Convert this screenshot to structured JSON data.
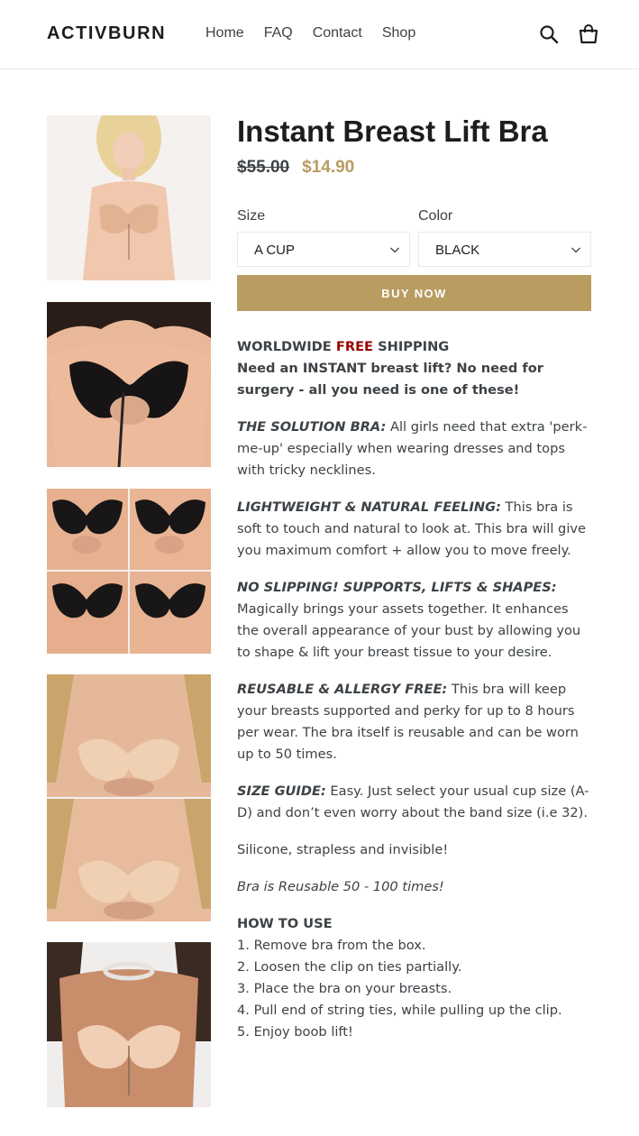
{
  "header": {
    "logo": "ACTIVBURN",
    "nav": [
      "Home",
      "FAQ",
      "Contact",
      "Shop"
    ],
    "search_icon": "search-icon",
    "cart_icon": "cart-icon"
  },
  "product": {
    "title": "Instant Breast Lift Bra",
    "price_original": "$55.00",
    "price_sale": "$14.90",
    "size_label": "Size",
    "size_value": "A CUP",
    "color_label": "Color",
    "color_value": "BLACK",
    "buy_label": "BUY NOW",
    "accent_color": "#b89c60"
  },
  "gallery": [
    {
      "alt": "model wearing nude strapless bra"
    },
    {
      "alt": "black adhesive bra close-up"
    },
    {
      "alt": "four-panel black bra lace-up"
    },
    {
      "alt": "nude bra before and after"
    },
    {
      "alt": "nude bra with choker necklace"
    }
  ],
  "description": {
    "shipping_pre": "WORLDWIDE ",
    "shipping_free": "FREE",
    "shipping_post": " SHIPPING",
    "intro": "Need an INSTANT breast lift? No need for surgery - all you need is one of these!",
    "solution_head": "THE SOLUTION BRA:",
    "solution_text": " All girls need that extra 'perk-me-up' especially when wearing dresses and tops with tricky necklines.",
    "light_head": "LIGHTWEIGHT & NATURAL FEELING:",
    "light_text": " This bra is soft to touch and natural to look at. This bra will give you maximum comfort + allow you to move freely.",
    "slip_head": "NO SLIPPING! SUPPORTS, LIFTS & SHAPES:",
    "slip_text": " Magically brings your assets together. It enhances the overall appearance of your bust by allowing you to shape & lift your breast tissue to your desire.",
    "reuse_head": "REUSABLE & ALLERGY FREE:",
    "reuse_text": " This bra will keep your breasts supported and perky for up to 8 hours per wear. The bra itself is reusable and can be worn up to 50 times.",
    "size_head": "SIZE GUIDE:",
    "size_text": " Easy. Just select your usual cup size (A-D) and don’t even worry about the band size (i.e 32).",
    "silicone": "Silicone, strapless and invisible!",
    "reusable_italic": "Bra is Reusable 50 - 100 times!",
    "howto_head": "HOW TO USE",
    "steps": [
      "1. Remove bra from the box.",
      "2. Loosen the clip on ties partially.",
      "3. Place the bra on your breasts.",
      "4. Pull end of string ties, while pulling up the clip.",
      "5. Enjoy boob lift!"
    ]
  }
}
